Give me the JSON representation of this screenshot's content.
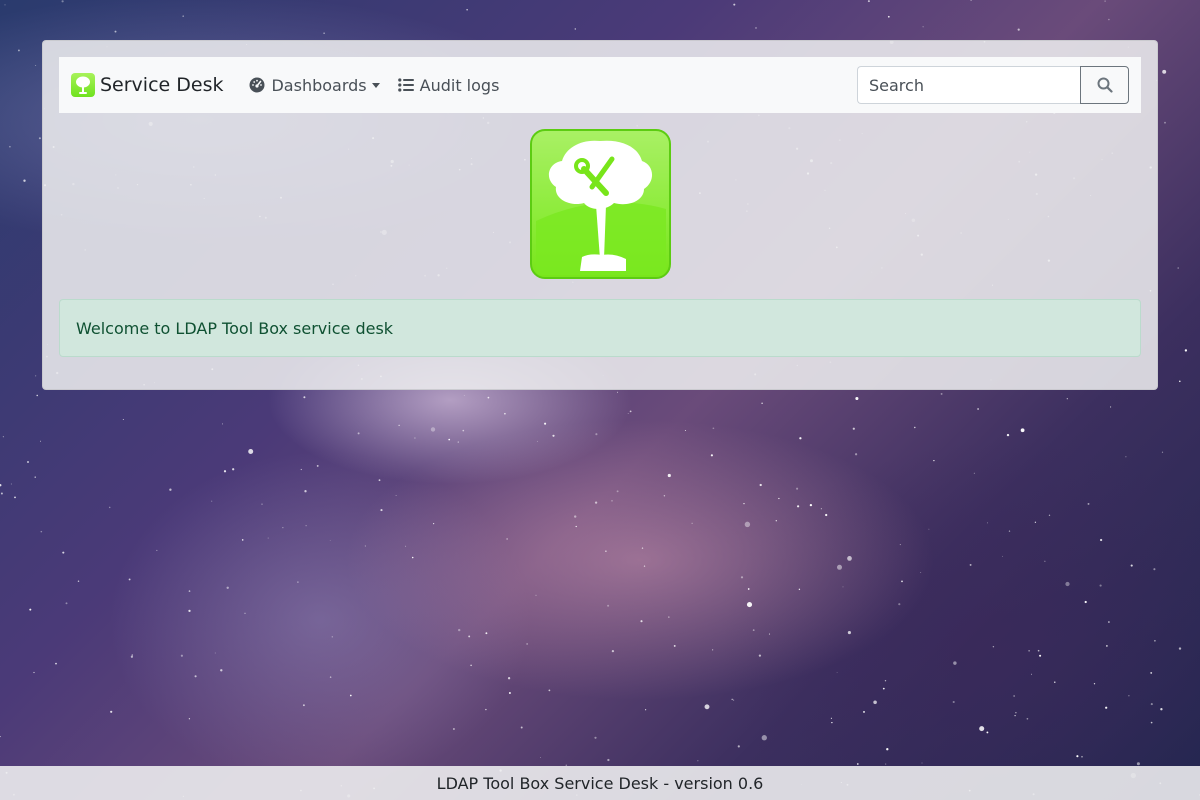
{
  "app": {
    "brand_name": "Service Desk",
    "brand_color": "#7ee82a"
  },
  "navbar": {
    "items": [
      {
        "label": "Dashboards",
        "icon": "gauge-icon",
        "has_dropdown": true
      },
      {
        "label": "Audit logs",
        "icon": "list-icon",
        "has_dropdown": false
      }
    ]
  },
  "search": {
    "placeholder": "Search",
    "value": "",
    "button_icon": "search-icon"
  },
  "main": {
    "welcome_message": "Welcome to LDAP Tool Box service desk",
    "alert_color": "#d1e7dd"
  },
  "footer": {
    "text": "LDAP Tool Box Service Desk - version 0.6"
  }
}
